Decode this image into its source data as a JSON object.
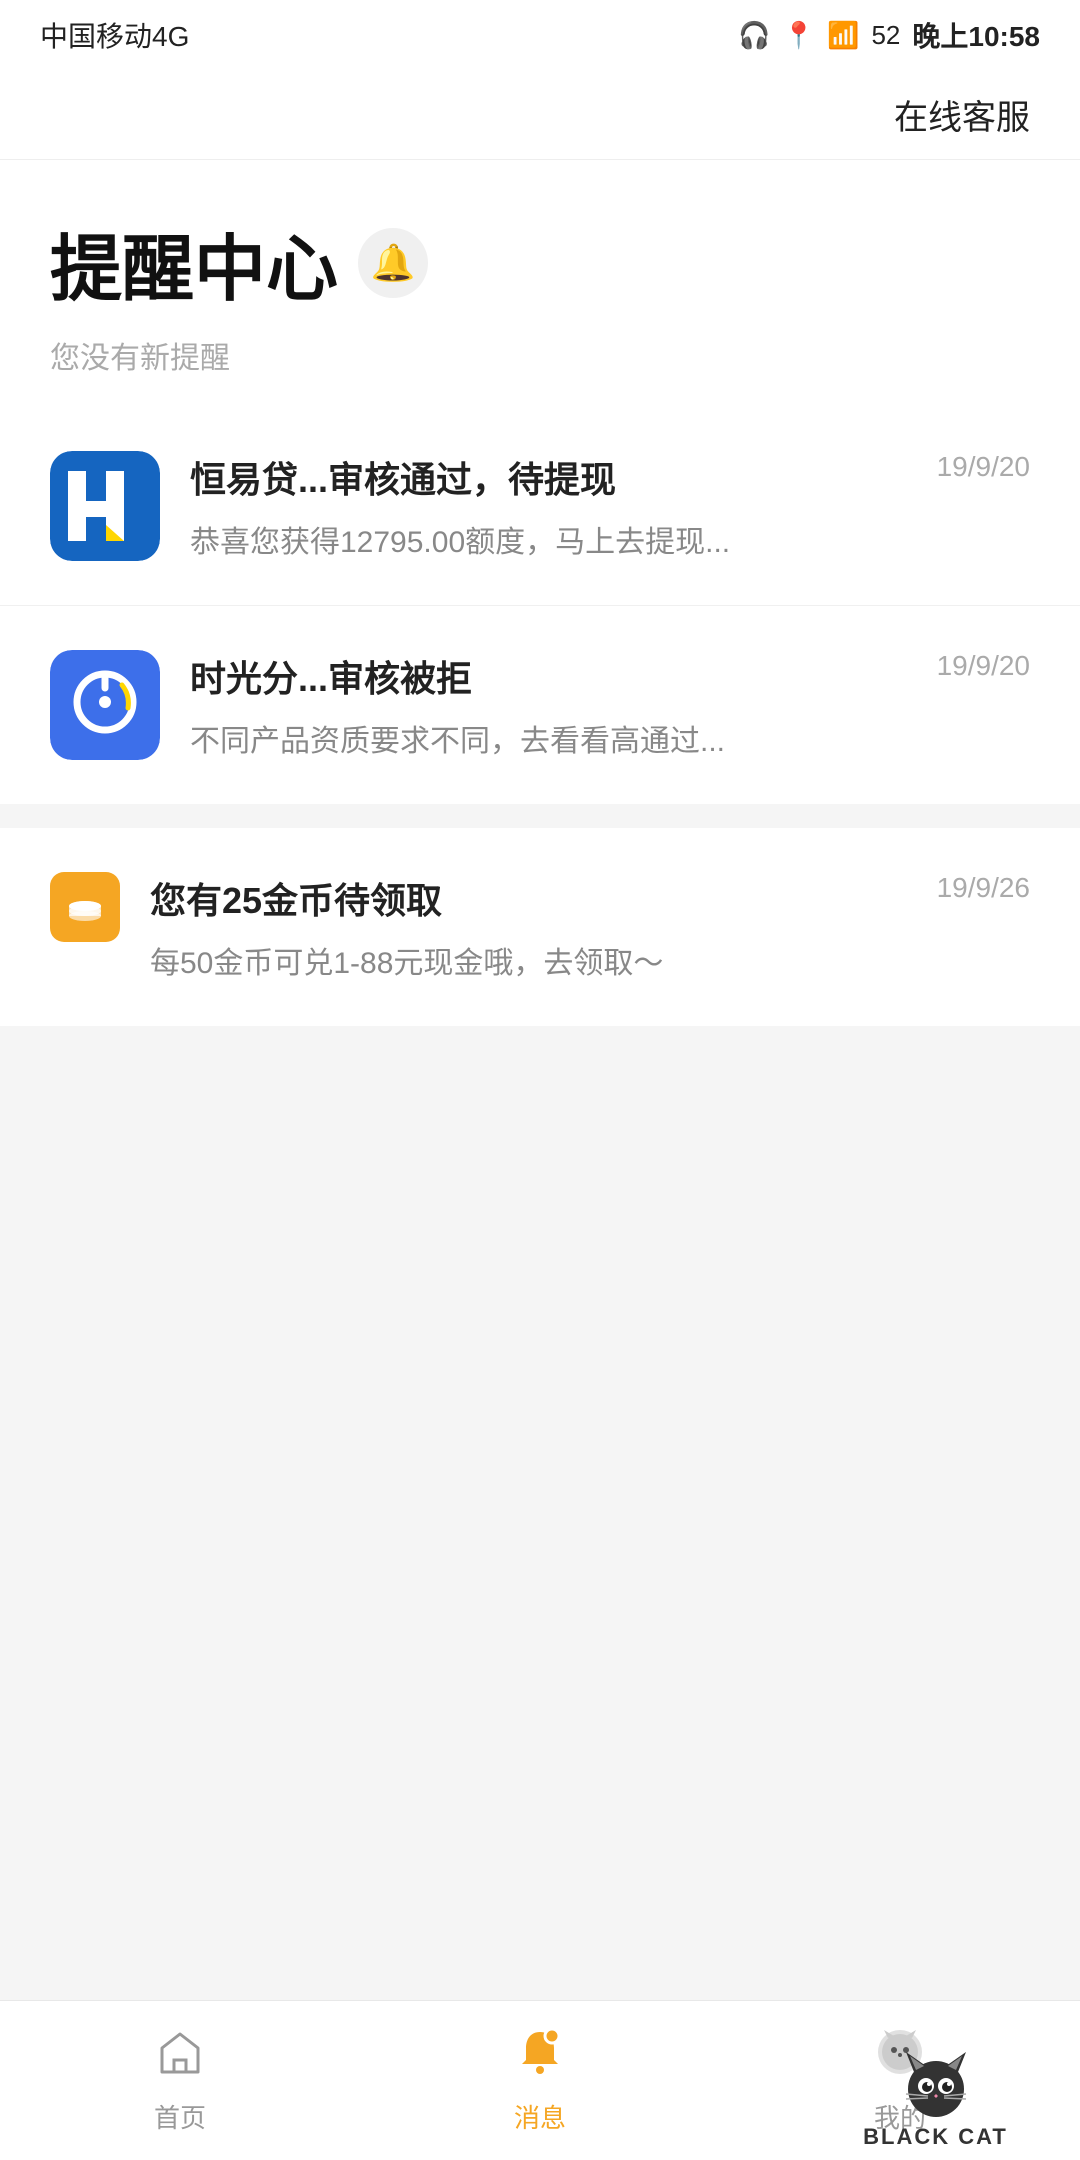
{
  "statusBar": {
    "carrier": "中国移动4G",
    "time": "晚上10:58",
    "battery": "52"
  },
  "header": {
    "serviceLabel": "在线客服"
  },
  "pageTitle": {
    "title": "提醒中心",
    "subtitle": "您没有新提醒"
  },
  "notifications": [
    {
      "id": "hyd",
      "title": "恒易贷...审核通过，待提现",
      "body": "恭喜您获得12795.00额度，马上去提现...",
      "date": "19/9/20",
      "iconType": "hyd"
    },
    {
      "id": "sgf",
      "title": "时光分...审核被拒",
      "body": "不同产品资质要求不同，去看看高通过...",
      "date": "19/9/20",
      "iconType": "sgf"
    }
  ],
  "coinNotification": {
    "title": "您有25金币待领取",
    "body": "每50金币可兑1-88元现金哦，去领取～",
    "date": "19/9/26"
  },
  "bottomNav": {
    "items": [
      {
        "label": "首页",
        "icon": "home",
        "active": false
      },
      {
        "label": "消息",
        "icon": "bell",
        "active": true
      },
      {
        "label": "我的",
        "icon": "blackcat",
        "active": false
      }
    ]
  },
  "watermark": {
    "line1": "我的",
    "line2": "BLACK CAT"
  }
}
